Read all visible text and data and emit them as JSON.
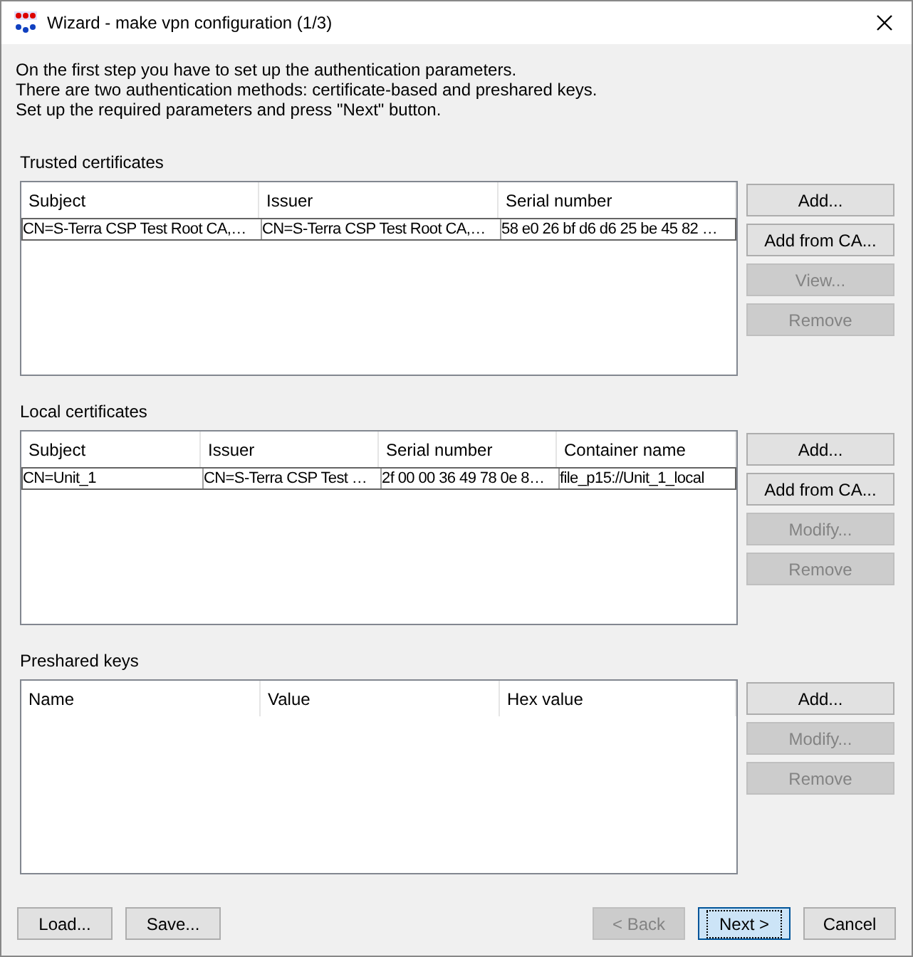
{
  "window": {
    "title": "Wizard - make vpn configuration (1/3)"
  },
  "intro": [
    "On the first step you have to set up the authentication parameters.",
    "There are two authentication methods: certificate-based and preshared keys.",
    "Set up the required parameters and press \"Next\" button."
  ],
  "sections": [
    {
      "label": "Trusted certificates",
      "columns": [
        "Subject",
        "Issuer",
        "Serial number"
      ],
      "rows": [
        [
          "CN=S-Terra CSP Test Root CA,…",
          "CN=S-Terra CSP Test Root CA,…",
          "58 e0 26 bf d6 d6 25 be 45 82 …"
        ]
      ],
      "buttons": [
        {
          "label": "Add...",
          "disabled": false
        },
        {
          "label": "Add from CA...",
          "disabled": false
        },
        {
          "label": "View...",
          "disabled": true
        },
        {
          "label": "Remove",
          "disabled": true
        }
      ]
    },
    {
      "label": "Local certificates",
      "columns": [
        "Subject",
        "Issuer",
        "Serial number",
        "Container name"
      ],
      "rows": [
        [
          "CN=Unit_1",
          "CN=S-Terra CSP Test …",
          "2f 00 00 36 49 78 0e 8…",
          "file_p15://Unit_1_local"
        ]
      ],
      "buttons": [
        {
          "label": "Add...",
          "disabled": false
        },
        {
          "label": "Add from CA...",
          "disabled": false
        },
        {
          "label": "Modify...",
          "disabled": true
        },
        {
          "label": "Remove",
          "disabled": true
        }
      ]
    },
    {
      "label": "Preshared keys",
      "columns": [
        "Name",
        "Value",
        "Hex value"
      ],
      "buttons": [
        {
          "label": "Add...",
          "disabled": false
        },
        {
          "label": "Modify...",
          "disabled": true
        },
        {
          "label": "Remove",
          "disabled": true
        }
      ]
    }
  ],
  "footer_left": [
    {
      "label": "Load...",
      "disabled": false,
      "default": false
    },
    {
      "label": "Save...",
      "disabled": false,
      "default": false
    }
  ],
  "footer_right": [
    {
      "label": "< Back",
      "disabled": true,
      "default": false
    },
    {
      "label": "Next >",
      "disabled": false,
      "default": true
    },
    {
      "label": "Cancel",
      "disabled": false,
      "default": false
    }
  ]
}
